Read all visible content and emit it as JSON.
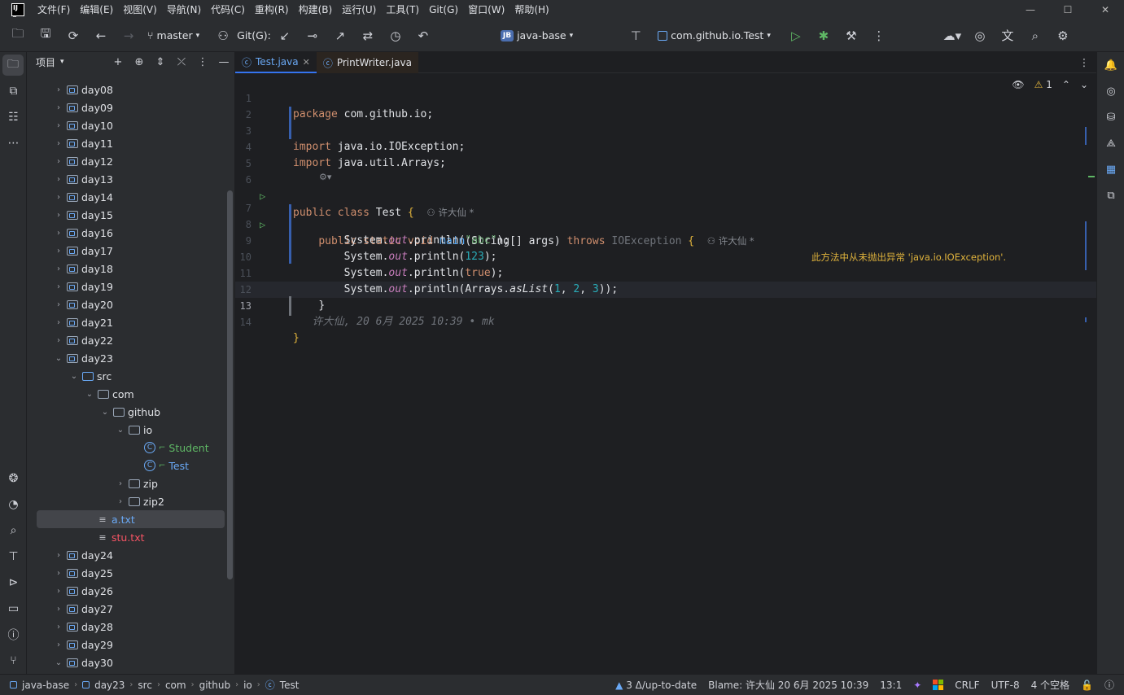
{
  "menu": [
    "文件(F)",
    "编辑(E)",
    "视图(V)",
    "导航(N)",
    "代码(C)",
    "重构(R)",
    "构建(B)",
    "运行(U)",
    "工具(T)",
    "Git(G)",
    "窗口(W)",
    "帮助(H)"
  ],
  "toolbar": {
    "branch": "master",
    "git_label": "Git(G):",
    "project_badge": "JB",
    "project": "java-base",
    "run_config": "com.github.io.Test"
  },
  "project_panel": {
    "title": "项目",
    "tree": [
      {
        "label": "day08",
        "type": "module",
        "level": 1,
        "expanded": false
      },
      {
        "label": "day09",
        "type": "module",
        "level": 1,
        "expanded": false
      },
      {
        "label": "day10",
        "type": "module",
        "level": 1,
        "expanded": false
      },
      {
        "label": "day11",
        "type": "module",
        "level": 1,
        "expanded": false
      },
      {
        "label": "day12",
        "type": "module",
        "level": 1,
        "expanded": false
      },
      {
        "label": "day13",
        "type": "module",
        "level": 1,
        "expanded": false
      },
      {
        "label": "day14",
        "type": "module",
        "level": 1,
        "expanded": false
      },
      {
        "label": "day15",
        "type": "module",
        "level": 1,
        "expanded": false
      },
      {
        "label": "day16",
        "type": "module",
        "level": 1,
        "expanded": false
      },
      {
        "label": "day17",
        "type": "module",
        "level": 1,
        "expanded": false
      },
      {
        "label": "day18",
        "type": "module",
        "level": 1,
        "expanded": false
      },
      {
        "label": "day19",
        "type": "module",
        "level": 1,
        "expanded": false
      },
      {
        "label": "day20",
        "type": "module",
        "level": 1,
        "expanded": false
      },
      {
        "label": "day21",
        "type": "module",
        "level": 1,
        "expanded": false
      },
      {
        "label": "day22",
        "type": "module",
        "level": 1,
        "expanded": false
      },
      {
        "label": "day23",
        "type": "module",
        "level": 1,
        "expanded": true
      },
      {
        "label": "src",
        "type": "src",
        "level": 2,
        "expanded": true
      },
      {
        "label": "com",
        "type": "package",
        "level": 3,
        "expanded": true
      },
      {
        "label": "github",
        "type": "package",
        "level": 4,
        "expanded": true
      },
      {
        "label": "io",
        "type": "package",
        "level": 5,
        "expanded": true
      },
      {
        "label": "Student",
        "type": "class",
        "level": 6,
        "color": "#5fb865"
      },
      {
        "label": "Test",
        "type": "class",
        "level": 6,
        "color": "#6aa9f5"
      },
      {
        "label": "zip",
        "type": "package",
        "level": 5,
        "expanded": false
      },
      {
        "label": "zip2",
        "type": "package",
        "level": 5,
        "expanded": false
      },
      {
        "label": "a.txt",
        "type": "text",
        "level": 3,
        "color": "#6aa9f5",
        "selected": true
      },
      {
        "label": "stu.txt",
        "type": "text",
        "level": 3,
        "color": "#f75464"
      },
      {
        "label": "day24",
        "type": "module",
        "level": 1,
        "expanded": false
      },
      {
        "label": "day25",
        "type": "module",
        "level": 1,
        "expanded": false
      },
      {
        "label": "day26",
        "type": "module",
        "level": 1,
        "expanded": false
      },
      {
        "label": "day27",
        "type": "module",
        "level": 1,
        "expanded": false
      },
      {
        "label": "day28",
        "type": "module",
        "level": 1,
        "expanded": false
      },
      {
        "label": "day29",
        "type": "module",
        "level": 1,
        "expanded": false
      },
      {
        "label": "day30",
        "type": "module",
        "level": 1,
        "expanded": true
      }
    ]
  },
  "tabs": [
    {
      "label": "Test.java",
      "active": true
    },
    {
      "label": "PrintWriter.java",
      "active": false
    }
  ],
  "editor": {
    "warning_count": "1",
    "line_numbers": [
      "1",
      "2",
      "3",
      "4",
      "5",
      "6",
      "7",
      "8",
      "9",
      "10",
      "11",
      "12",
      "13",
      "14"
    ],
    "l1": {
      "kw": "package",
      "rest": " com.github.io;"
    },
    "l3": {
      "kw": "import",
      "rest": " java.io.IOException;"
    },
    "l4": {
      "kw": "import",
      "rest": " java.util.Arrays;"
    },
    "l6": {
      "kw": "public class",
      "name": " Test ",
      "brace": "{",
      "author": "许大仙 *"
    },
    "l7": {
      "kw1": "public static void",
      "name": "main",
      "sig": "(String[] args) ",
      "kw2": "throws",
      "exc": " IOException ",
      "brace": "{",
      "author": "许大仙 *",
      "warning": "此方法中从未抛出异常 'java.io.IOException'."
    },
    "l8": {
      "pre": "System.",
      "field": "out",
      "mid": ".println(",
      "arg": "\"abc\"",
      "end": ");"
    },
    "l9": {
      "pre": "System.",
      "field": "out",
      "mid": ".println(",
      "arg": "123",
      "end": ");"
    },
    "l10": {
      "pre": "System.",
      "field": "out",
      "mid": ".println(",
      "arg": "true",
      "end": ");"
    },
    "l11": {
      "pre": "System.",
      "field": "out",
      "mid": ".println(Arrays.",
      "method": "asList",
      "open": "(",
      "n1": "1",
      "c1": ", ",
      "n2": "2",
      "c2": ", ",
      "n3": "3",
      "end": "));"
    },
    "l12": "}",
    "l13_blame": "许大仙, 20 6月 2025 10:39 • mk",
    "l14": "}"
  },
  "status": {
    "breadcrumb": [
      "java-base",
      "day23",
      "src",
      "com",
      "github",
      "io",
      "Test"
    ],
    "vcs": "3 Δ/up-to-date",
    "blame": "Blame: 许大仙 20 6月 2025 10:39",
    "position": "13:1",
    "line_sep": "CRLF",
    "encoding": "UTF-8",
    "indent": "4 个空格"
  }
}
